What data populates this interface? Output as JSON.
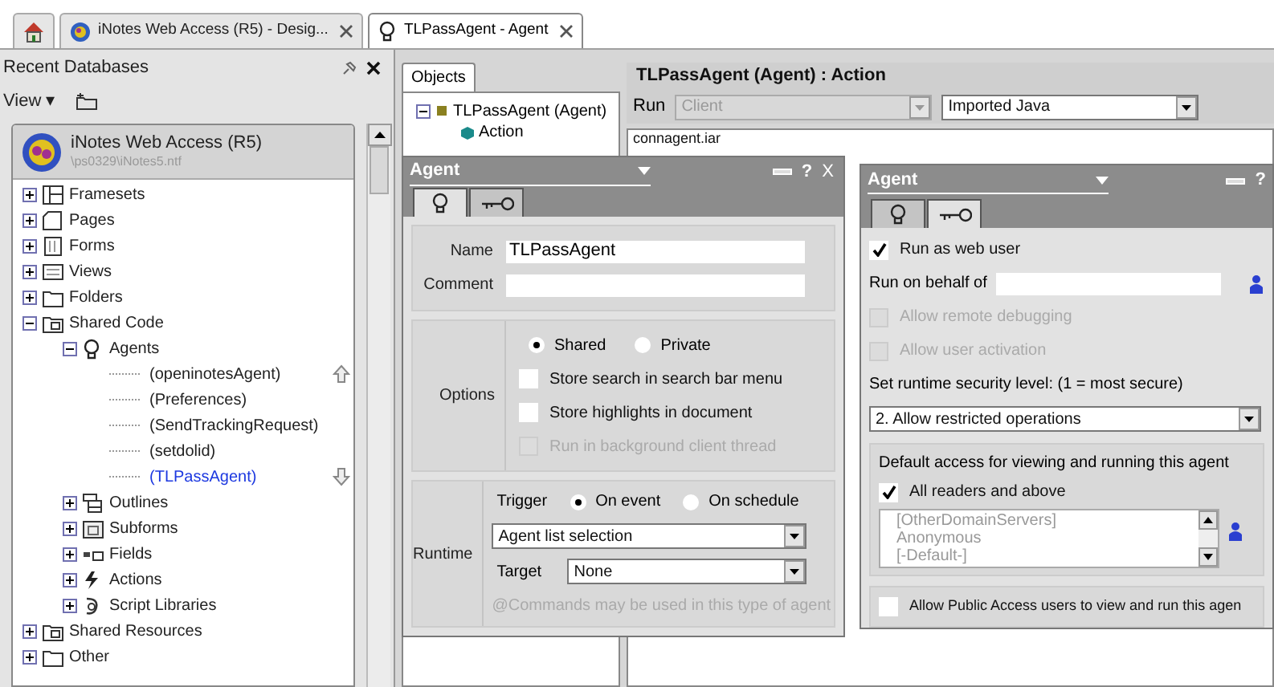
{
  "tabs": [
    {
      "kind": "home",
      "selected": false
    },
    {
      "kind": "database",
      "label": "iNotes Web Access (R5) - Desig...",
      "selected": false
    },
    {
      "kind": "agent",
      "label": "TLPassAgent - Agent",
      "selected": true
    }
  ],
  "navigator": {
    "title": "Recent Databases",
    "view_menu": "View ▾",
    "database": {
      "title": "iNotes Web Access (R5)",
      "path": "\\ps0329\\iNotes5.ntf"
    },
    "tree": [
      {
        "kind": "framesets",
        "label": "Framesets",
        "expanded": false
      },
      {
        "kind": "pages",
        "label": "Pages",
        "expanded": false
      },
      {
        "kind": "forms",
        "label": "Forms",
        "expanded": false
      },
      {
        "kind": "views",
        "label": "Views",
        "expanded": false
      },
      {
        "kind": "folders",
        "label": "Folders",
        "expanded": false
      },
      {
        "kind": "shared",
        "label": "Shared Code",
        "expanded": true,
        "children": [
          {
            "kind": "agents",
            "label": "Agents",
            "expanded": true,
            "children": [
              {
                "kind": "agent",
                "label": "(openinotesAgent)",
                "selected": false
              },
              {
                "kind": "agent",
                "label": "(Preferences)",
                "selected": false
              },
              {
                "kind": "agent",
                "label": "(SendTrackingRequest)",
                "selected": false
              },
              {
                "kind": "agent",
                "label": "(setdolid)",
                "selected": false
              },
              {
                "kind": "agent",
                "label": "(TLPassAgent)",
                "selected": true
              }
            ]
          },
          {
            "kind": "outlines",
            "label": "Outlines",
            "expanded": false
          },
          {
            "kind": "subforms",
            "label": "Subforms",
            "expanded": false
          },
          {
            "kind": "fields",
            "label": "Fields",
            "expanded": false
          },
          {
            "kind": "actions",
            "label": "Actions",
            "expanded": false
          },
          {
            "kind": "scripts",
            "label": "Script Libraries",
            "expanded": false
          }
        ]
      },
      {
        "kind": "shared",
        "label": "Shared Resources",
        "expanded": false
      },
      {
        "kind": "folders",
        "label": "Other",
        "expanded": false
      }
    ]
  },
  "objects": {
    "tab": "Objects",
    "tree": [
      {
        "label": "TLPassAgent (Agent)",
        "expanded": true,
        "children": [
          {
            "label": "Action"
          }
        ]
      }
    ]
  },
  "editor": {
    "title": "TLPassAgent (Agent) : Action",
    "run_label": "Run",
    "run_target": {
      "value": "Client",
      "disabled": true
    },
    "language": "Imported Java",
    "code": "connagent.iar"
  },
  "basics_dialog": {
    "title": "Agent",
    "help": "?",
    "close": "X",
    "tabs": [
      {
        "kind": "basics",
        "selected": true
      },
      {
        "kind": "security",
        "selected": false
      }
    ],
    "name_label": "Name",
    "name": "TLPassAgent",
    "comment_label": "Comment",
    "options_label": "Options",
    "sharing": [
      {
        "label": "Shared",
        "selected": true
      },
      {
        "label": "Private",
        "selected": false
      }
    ],
    "options": [
      {
        "label": "Store search in search bar menu",
        "checked": false,
        "disabled": false
      },
      {
        "label": "Store highlights in document",
        "checked": false,
        "disabled": false
      },
      {
        "label": "Run in background client thread",
        "checked": false,
        "disabled": true
      }
    ],
    "runtime_label": "Runtime",
    "trigger_label": "Trigger",
    "triggers": [
      {
        "label": "On event",
        "selected": true
      },
      {
        "label": "On schedule",
        "selected": false
      }
    ],
    "trigger_event": "Agent list selection",
    "target_label": "Target",
    "target": "None",
    "note": "@Commands may be used in this type of agent"
  },
  "security_dialog": {
    "title": "Agent",
    "help": "?",
    "tabs": [
      {
        "kind": "basics",
        "selected": false
      },
      {
        "kind": "security",
        "selected": true
      }
    ],
    "run_as_web_user": {
      "label": "Run as web user",
      "checked": true,
      "disabled": false
    },
    "run_on_behalf_label": "Run on behalf of",
    "debug_options": [
      {
        "label": "Allow remote debugging",
        "checked": false,
        "disabled": true
      },
      {
        "label": "Allow user activation",
        "checked": false,
        "disabled": true
      }
    ],
    "security_level_label": "Set runtime security level: (1 = most secure)",
    "security_level": "2. Allow restricted operations",
    "access_label": "Default access for viewing and running this agent",
    "all_readers": {
      "label": "All readers and above",
      "checked": true,
      "disabled": false
    },
    "access_list": [
      "[OtherDomainServers]",
      "Anonymous",
      "[-Default-]"
    ],
    "public_access": {
      "label": "Allow Public Access users to view and run this agen",
      "checked": false,
      "disabled": false
    }
  }
}
